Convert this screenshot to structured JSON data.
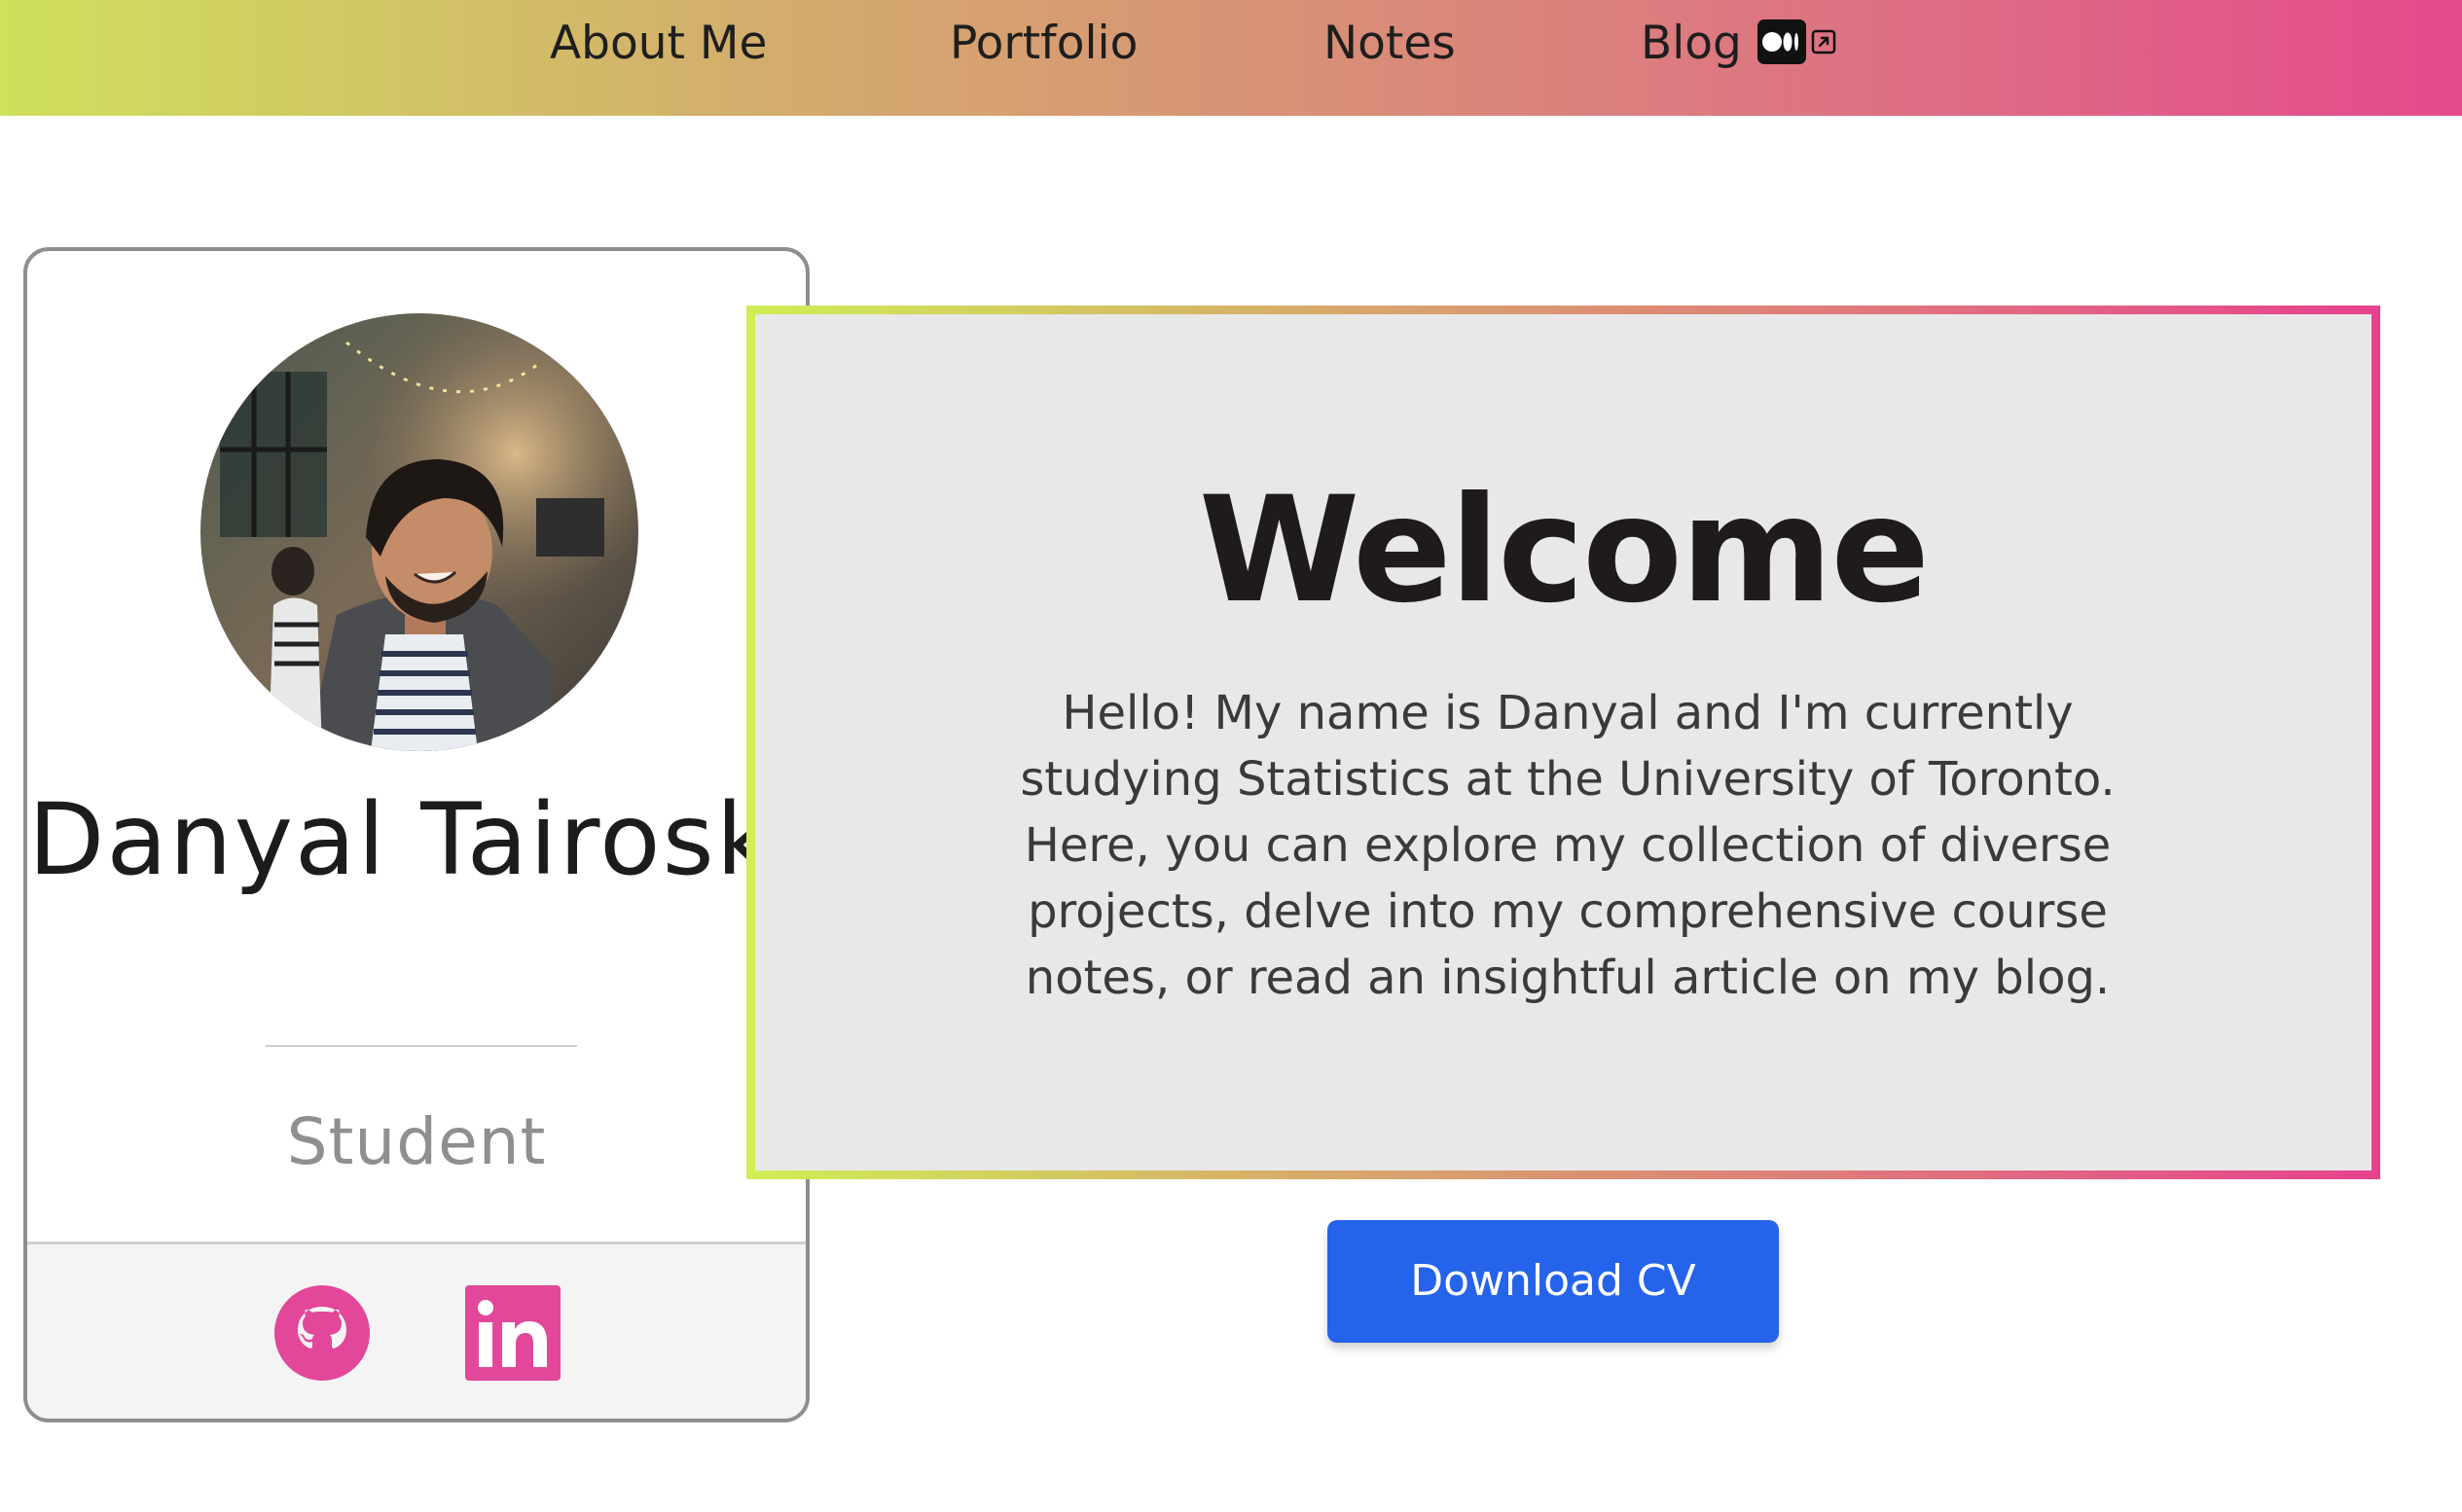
{
  "nav": {
    "items": [
      {
        "label": "About Me"
      },
      {
        "label": "Portfolio"
      },
      {
        "label": "Notes"
      },
      {
        "label": "Blog"
      }
    ],
    "blog_icon": "medium-icon",
    "external_icon": "external-link-icon"
  },
  "profile": {
    "name": "Danyal Tairoski",
    "role": "Student",
    "social": [
      {
        "icon": "github-icon",
        "color": "#e2479a"
      },
      {
        "icon": "linkedin-icon",
        "color": "#e2479a"
      }
    ]
  },
  "welcome": {
    "title": "Welcome",
    "text": "Hello! My name is Danyal and I'm currently studying Statistics at the University of Toronto. Here, you can explore my collection of diverse projects, delve into my comprehensive course notes, or read an insightful article on my blog."
  },
  "cta": {
    "download_label": "Download CV",
    "color": "#2563eb"
  },
  "colors": {
    "gradient_start": "#cfe05c",
    "gradient_end": "#e44a8c",
    "accent_pink": "#e2479a"
  }
}
